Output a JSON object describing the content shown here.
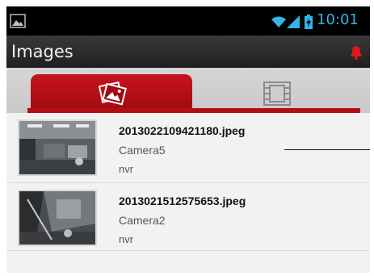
{
  "status_bar": {
    "time": "10:01",
    "time_color": "#33b5e5",
    "icons": [
      "image-notification-icon",
      "wifi-icon",
      "signal-icon",
      "battery-charging-icon"
    ]
  },
  "action_bar": {
    "title": "Images",
    "alarm_icon": "bell-icon",
    "alarm_color": "#e0161e"
  },
  "tabs": [
    {
      "icon": "images-icon",
      "selected": true
    },
    {
      "icon": "film-icon",
      "selected": false
    }
  ],
  "accent_color": "#b40d16",
  "items": [
    {
      "filename": "2013022109421180.jpeg",
      "camera": "Camera5",
      "source": "nvr"
    },
    {
      "filename": "2013021512575653.jpeg",
      "camera": "Camera2",
      "source": "nvr"
    }
  ]
}
